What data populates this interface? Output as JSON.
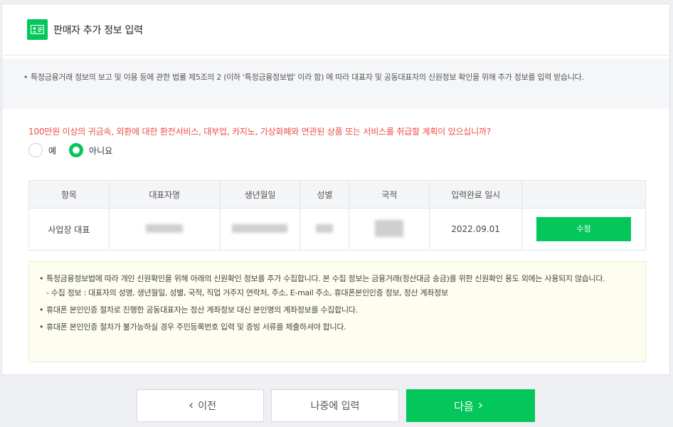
{
  "header": {
    "title": "판매자 추가 정보 입력",
    "icon": "id-card-icon"
  },
  "notice": {
    "bullet": "•",
    "text": "특정금융거래 정보의 보고 및 이용 등에 관한 법률 제5조의 2 (이하 '특정금융정보법' 이라 함) 에 따라 대표자 및 공동대표자의 신원정보 확인을 위해 추가 정보를 입력 받습니다."
  },
  "question": {
    "text": "100만원 이상의 귀금속, 외환에 대한 환전서비스, 대부업, 카지노, 가상화폐와 연관된 상품 또는 서비스를 취급할 계획이 있으십니까?",
    "options": [
      {
        "label": "예",
        "checked": false
      },
      {
        "label": "아니요",
        "checked": true
      }
    ]
  },
  "table": {
    "headers": [
      "항목",
      "대표자명",
      "생년월일",
      "성별",
      "국적",
      "입력완료 일시",
      ""
    ],
    "row": {
      "item": "사업장 대표",
      "date": "2022.09.01",
      "edit_label": "수정"
    }
  },
  "guide": {
    "bullet": "•",
    "item1": "특정금융정보법에 따라 개인 신원확인을 위해 아래의 신원확인 정보를 추가 수집합니다. 본 수집 정보는 금융거래(정산대금 송금)를 위한 신원확인 용도 외에는 사용되지 않습니다.",
    "item1_sub": "- 수집 정보 : 대표자의 성명, 생년월일, 성별, 국적, 직업 거주지 연락처, 주소, E-mail 주소, 휴대폰본인인증 정보, 정산 계좌정보",
    "item2": "휴대폰 본인인증 절차로 진행한 공동대표자는 정산 계좌정보 대신 본인명의 계좌정보를 수집합니다.",
    "item3": "휴대폰 본인인증 절차가 불가능하실 경우 주민등록번호 입력 및 증빙 서류를 제출하셔야 합니다."
  },
  "footer": {
    "prev_label": "이전",
    "later_label": "나중에 입력",
    "next_label": "다음",
    "prev_icon": "‹",
    "next_icon": "›"
  },
  "colors": {
    "accent": "#03c75a",
    "question": "#ef4b42"
  }
}
